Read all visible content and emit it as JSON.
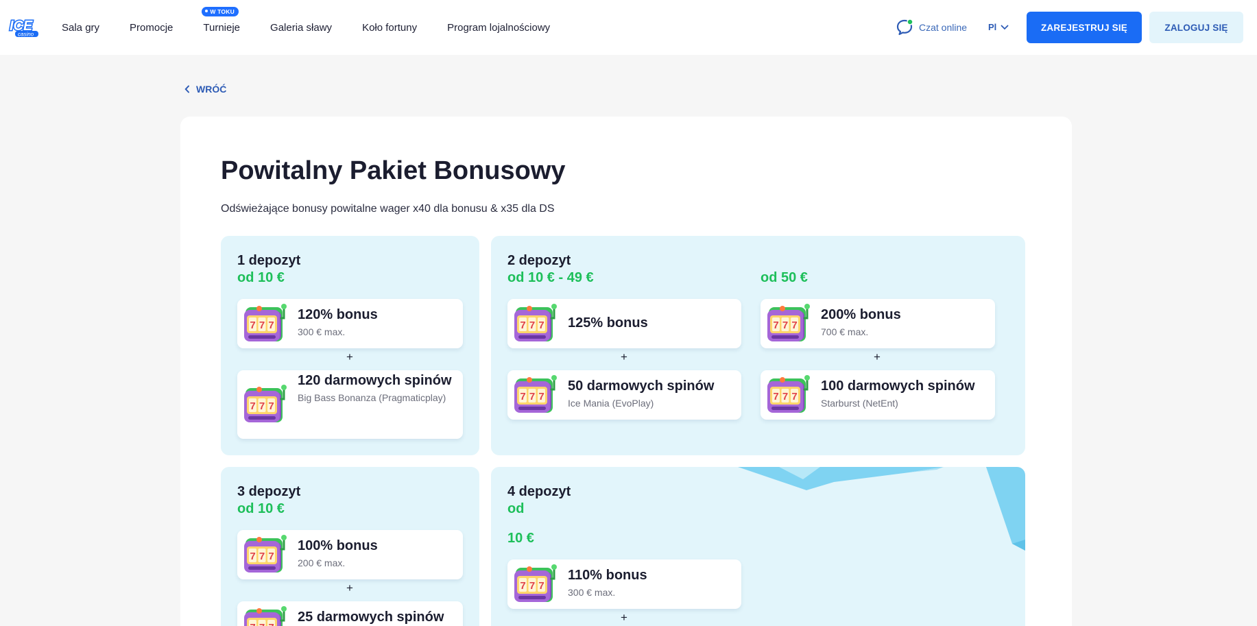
{
  "header": {
    "logo_text": "ICE",
    "logo_sub": "casino",
    "nav": [
      {
        "label": "Sala gry"
      },
      {
        "label": "Promocje"
      },
      {
        "label": "Turnieje",
        "badge": "W TOKU"
      },
      {
        "label": "Galeria sławy"
      },
      {
        "label": "Koło fortuny"
      },
      {
        "label": "Program lojalnościowy"
      }
    ],
    "chat_label": "Czat online",
    "language": "Pl",
    "register_label": "ZAREJESTRUJ SIĘ",
    "login_label": "ZALOGUJ SIĘ",
    "colors": {
      "primary": "#1a6cf5",
      "accent_green": "#1dbf5a",
      "panel_bg": "#e2f5fb"
    }
  },
  "back_label": "WRÓĆ",
  "page": {
    "title": "Powitalny Pakiet Bonusowy",
    "subtitle": "Odświeżające bonusy powitalne wager x40 dla bonusu & x35 dla DS"
  },
  "deposits": {
    "d1": {
      "title": "1 depozyt",
      "range": "od 10 €",
      "bonus": {
        "name": "120% bonus",
        "sub": "300 € max.",
        "icon": "slot-machine-icon"
      },
      "spins": {
        "name": "120 darmowych spinów",
        "sub": "Big Bass Bonanza (Pragmaticplay)",
        "icon": "slot-machine-icon"
      }
    },
    "d2": {
      "title": "2 depozyt",
      "tiers": [
        {
          "range": "od 10 € - 49 €",
          "bonus": {
            "name": "125% bonus",
            "sub": ""
          },
          "spins": {
            "name": "50 darmowych spinów",
            "sub": "Ice Mania (EvoPlay)"
          }
        },
        {
          "range": "od 50 €",
          "bonus": {
            "name": "200% bonus",
            "sub": "700 € max."
          },
          "spins": {
            "name": "100 darmowych spinów",
            "sub": "Starburst (NetEnt)"
          }
        }
      ]
    },
    "d3": {
      "title": "3 depozyt",
      "range": "od 10 €",
      "bonus": {
        "name": "100% bonus",
        "sub": "200 € max."
      },
      "spins": {
        "name": "25 darmowych spinów",
        "sub": ""
      }
    },
    "d4": {
      "title": "4 depozyt",
      "range_prefix": "od",
      "range": "10 €",
      "bonus": {
        "name": "110% bonus",
        "sub": "300 € max."
      }
    }
  },
  "plus_sign": "+"
}
